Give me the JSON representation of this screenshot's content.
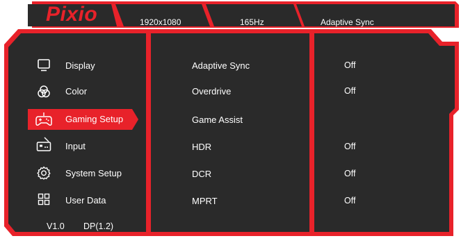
{
  "brand": {
    "logo_text": "Pixio",
    "accent_color": "#e8222a",
    "panel_color": "#2a2a2a"
  },
  "header": {
    "tabs": [
      {
        "label": "1920x1080"
      },
      {
        "label": "165Hz"
      },
      {
        "label": "Adaptive Sync"
      }
    ]
  },
  "sidebar": {
    "items": [
      {
        "label": "Display",
        "icon": "monitor-icon",
        "selected": false
      },
      {
        "label": "Color",
        "icon": "color-circles-icon",
        "selected": false
      },
      {
        "label": "Gaming Setup",
        "icon": "gamepad-icon",
        "selected": true
      },
      {
        "label": "Input",
        "icon": "input-port-icon",
        "selected": false
      },
      {
        "label": "System Setup",
        "icon": "gear-icon",
        "selected": false
      },
      {
        "label": "User Data",
        "icon": "grid-icon",
        "selected": false
      }
    ],
    "version": "V1.0",
    "port": "DP(1.2)"
  },
  "settings": [
    {
      "name": "Adaptive Sync",
      "value": "Off"
    },
    {
      "name": "Overdrive",
      "value": "Off"
    },
    {
      "name": "Game Assist",
      "value": ""
    },
    {
      "name": "HDR",
      "value": "Off"
    },
    {
      "name": "DCR",
      "value": "Off"
    },
    {
      "name": "MPRT",
      "value": "Off"
    }
  ]
}
